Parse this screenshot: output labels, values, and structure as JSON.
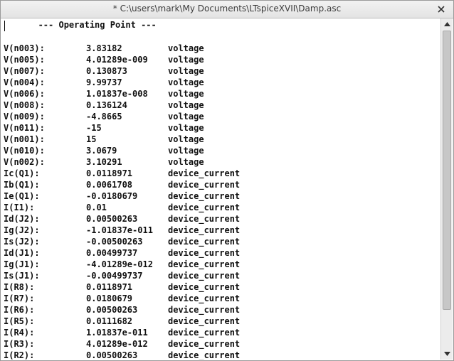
{
  "window": {
    "title": "* C:\\users\\mark\\My Documents\\LTspiceXVII\\Damp.asc"
  },
  "output": {
    "header": "       --- Operating Point ---",
    "rows": [
      {
        "name": "V(n003):",
        "value": "3.83182",
        "type": "voltage"
      },
      {
        "name": "V(n005):",
        "value": "4.01289e-009",
        "type": "voltage"
      },
      {
        "name": "V(n007):",
        "value": "0.130873",
        "type": "voltage"
      },
      {
        "name": "V(n004):",
        "value": "9.99737",
        "type": "voltage"
      },
      {
        "name": "V(n006):",
        "value": "1.01837e-008",
        "type": "voltage"
      },
      {
        "name": "V(n008):",
        "value": "0.136124",
        "type": "voltage"
      },
      {
        "name": "V(n009):",
        "value": "-4.8665",
        "type": "voltage"
      },
      {
        "name": "V(n011):",
        "value": "-15",
        "type": "voltage"
      },
      {
        "name": "V(n001):",
        "value": "15",
        "type": "voltage"
      },
      {
        "name": "V(n010):",
        "value": "3.0679",
        "type": "voltage"
      },
      {
        "name": "V(n002):",
        "value": "3.10291",
        "type": "voltage"
      },
      {
        "name": "Ic(Q1):",
        "value": "0.0118971",
        "type": "device_current"
      },
      {
        "name": "Ib(Q1):",
        "value": "0.0061708",
        "type": "device_current"
      },
      {
        "name": "Ie(Q1):",
        "value": "-0.0180679",
        "type": "device_current"
      },
      {
        "name": "I(I1):",
        "value": "0.01",
        "type": "device_current"
      },
      {
        "name": "Id(J2):",
        "value": "0.00500263",
        "type": "device_current"
      },
      {
        "name": "Ig(J2):",
        "value": "-1.01837e-011",
        "type": "device_current"
      },
      {
        "name": "Is(J2):",
        "value": "-0.00500263",
        "type": "device_current"
      },
      {
        "name": "Id(J1):",
        "value": "0.00499737",
        "type": "device_current"
      },
      {
        "name": "Ig(J1):",
        "value": "-4.01289e-012",
        "type": "device_current"
      },
      {
        "name": "Is(J1):",
        "value": "-0.00499737",
        "type": "device_current"
      },
      {
        "name": "I(R8):",
        "value": "0.0118971",
        "type": "device_current"
      },
      {
        "name": "I(R7):",
        "value": "0.0180679",
        "type": "device_current"
      },
      {
        "name": "I(R6):",
        "value": "0.00500263",
        "type": "device_current"
      },
      {
        "name": "I(R5):",
        "value": "0.0111682",
        "type": "device_current"
      },
      {
        "name": "I(R4):",
        "value": "1.01837e-011",
        "type": "device_current"
      },
      {
        "name": "I(R3):",
        "value": "4.01289e-012",
        "type": "device_current"
      },
      {
        "name": "I(R2):",
        "value": "0.00500263",
        "type": "device_current"
      }
    ]
  },
  "scrollbar": {
    "up_icon": "triangle-up-icon",
    "down_icon": "triangle-down-icon"
  },
  "icons": {
    "close": "close-icon"
  }
}
